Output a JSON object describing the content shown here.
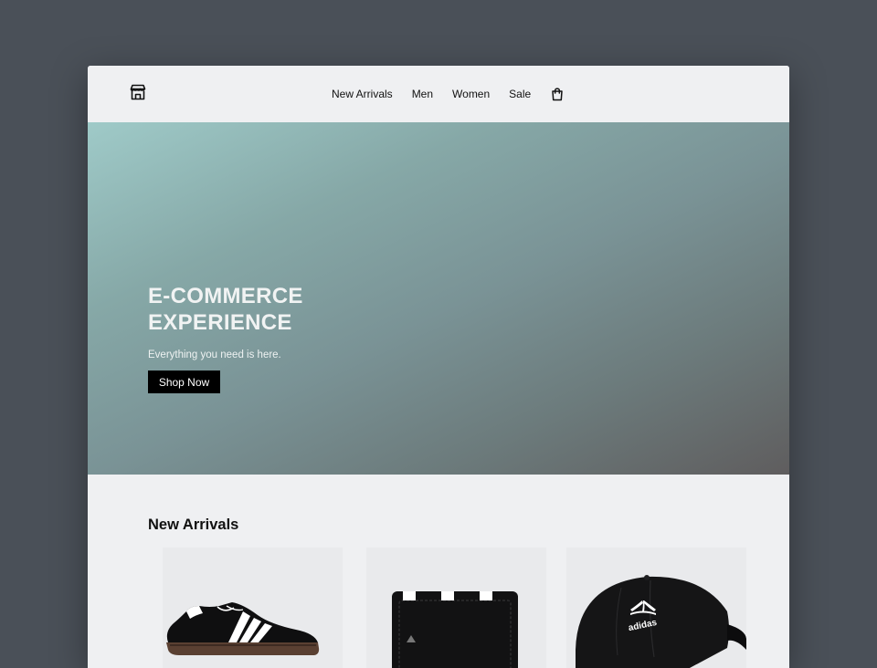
{
  "nav": {
    "items": [
      "New Arrivals",
      "Men",
      "Women",
      "Sale"
    ]
  },
  "icons": {
    "logo": "storefront-icon",
    "cart": "shopping-bag-icon"
  },
  "hero": {
    "title_line1": "E-COMMERCE",
    "title_line2": "EXPERIENCE",
    "subtitle": "Everything you need is here.",
    "cta_label": "Shop Now"
  },
  "new_arrivals": {
    "title": "New Arrivals",
    "products": [
      {
        "icon": "sneaker-image"
      },
      {
        "icon": "wallet-image"
      },
      {
        "icon": "cap-image"
      }
    ]
  },
  "colors": {
    "page_bg": "#4a5058",
    "window_bg": "#eff0f2",
    "button_bg": "#000000",
    "hero_gradient_start": "#9fcac8",
    "hero_gradient_end": "#5f5d5e"
  }
}
